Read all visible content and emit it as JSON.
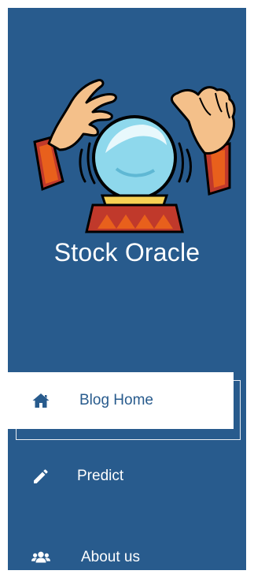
{
  "app": {
    "title": "Stock Oracle",
    "logo_icon": "crystal-ball-icon"
  },
  "nav": {
    "items": [
      {
        "label": "Blog Home",
        "icon": "home-icon",
        "active": true
      },
      {
        "label": "Predict",
        "icon": "pencil-icon",
        "active": false
      },
      {
        "label": "About us",
        "icon": "users-icon",
        "active": false
      }
    ]
  },
  "colors": {
    "sidebar_bg": "#285b8d",
    "active_bg": "#ffffff",
    "active_text": "#285b8d",
    "text": "#ffffff"
  }
}
